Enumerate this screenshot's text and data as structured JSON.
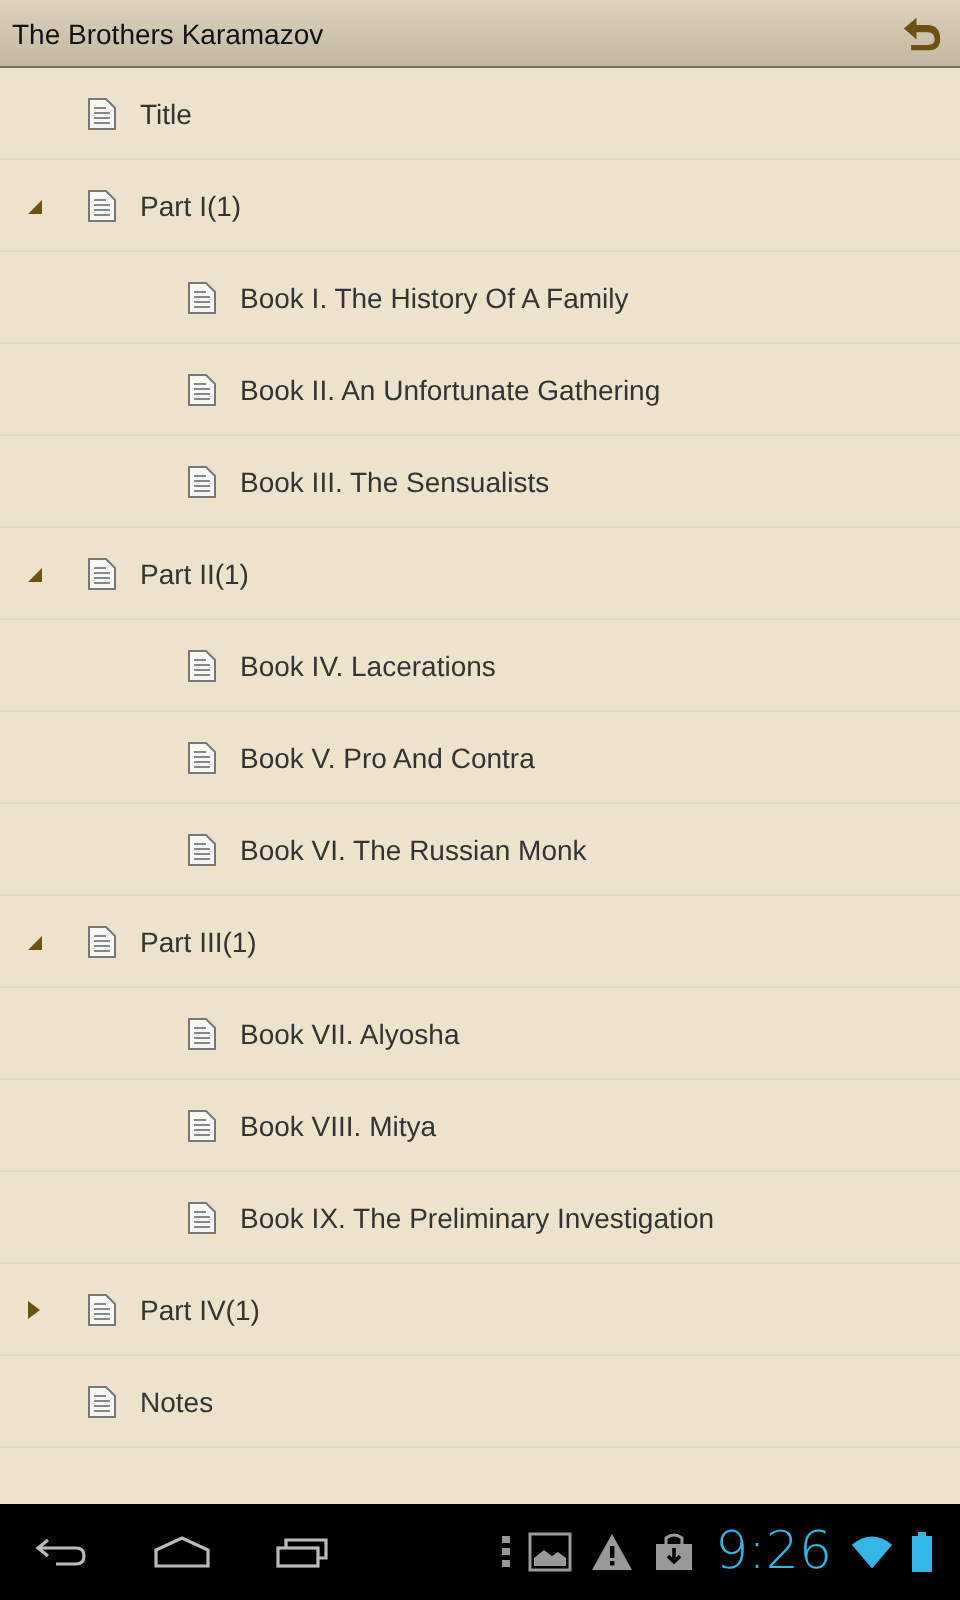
{
  "header": {
    "title": "The Brothers Karamazov"
  },
  "toc": [
    {
      "kind": "entry",
      "label": "Title"
    },
    {
      "kind": "part",
      "label": "Part I(1)",
      "expanded": true,
      "children": [
        {
          "label": "Book I. The History Of A Family"
        },
        {
          "label": "Book II. An Unfortunate Gathering"
        },
        {
          "label": "Book III. The Sensualists"
        }
      ]
    },
    {
      "kind": "part",
      "label": "Part II(1)",
      "expanded": true,
      "children": [
        {
          "label": "Book IV. Lacerations"
        },
        {
          "label": "Book V. Pro And Contra"
        },
        {
          "label": "Book VI. The Russian Monk"
        }
      ]
    },
    {
      "kind": "part",
      "label": "Part III(1)",
      "expanded": true,
      "children": [
        {
          "label": "Book VII. Alyosha"
        },
        {
          "label": "Book VIII. Mitya"
        },
        {
          "label": "Book IX. The Preliminary Investigation"
        }
      ]
    },
    {
      "kind": "part",
      "label": "Part IV(1)",
      "expanded": false
    },
    {
      "kind": "entry",
      "label": "Notes"
    }
  ],
  "status_bar": {
    "time": "9:26"
  }
}
